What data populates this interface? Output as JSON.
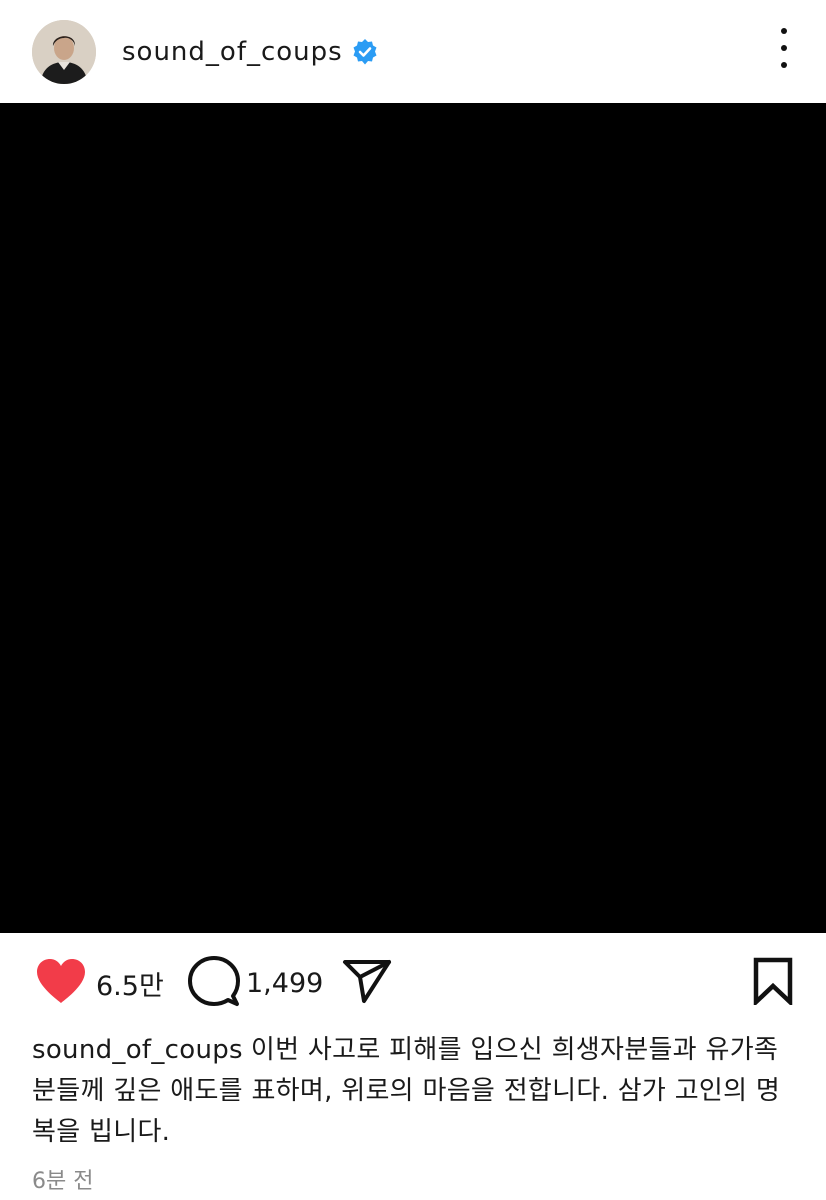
{
  "header": {
    "username": "sound_of_coups",
    "verified_icon": "verified-badge-icon",
    "menu_icon": "more-vertical-icon"
  },
  "colors": {
    "like": "#f23c49",
    "verified": "#2b9cf4",
    "media_background": "#000000"
  },
  "actions": {
    "likes": "6.5만",
    "comments": "1,499",
    "like_icon": "heart-filled-icon",
    "comment_icon": "comment-bubble-icon",
    "share_icon": "send-icon",
    "save_icon": "bookmark-icon"
  },
  "caption": {
    "username": "sound_of_coups",
    "text": "이번 사고로 피해를 입으신 희생자분들과 유가족분들께 깊은 애도를 표하며, 위로의 마음을 전합니다. 삼가 고인의 명복을 빕니다."
  },
  "timestamp": "6분 전"
}
